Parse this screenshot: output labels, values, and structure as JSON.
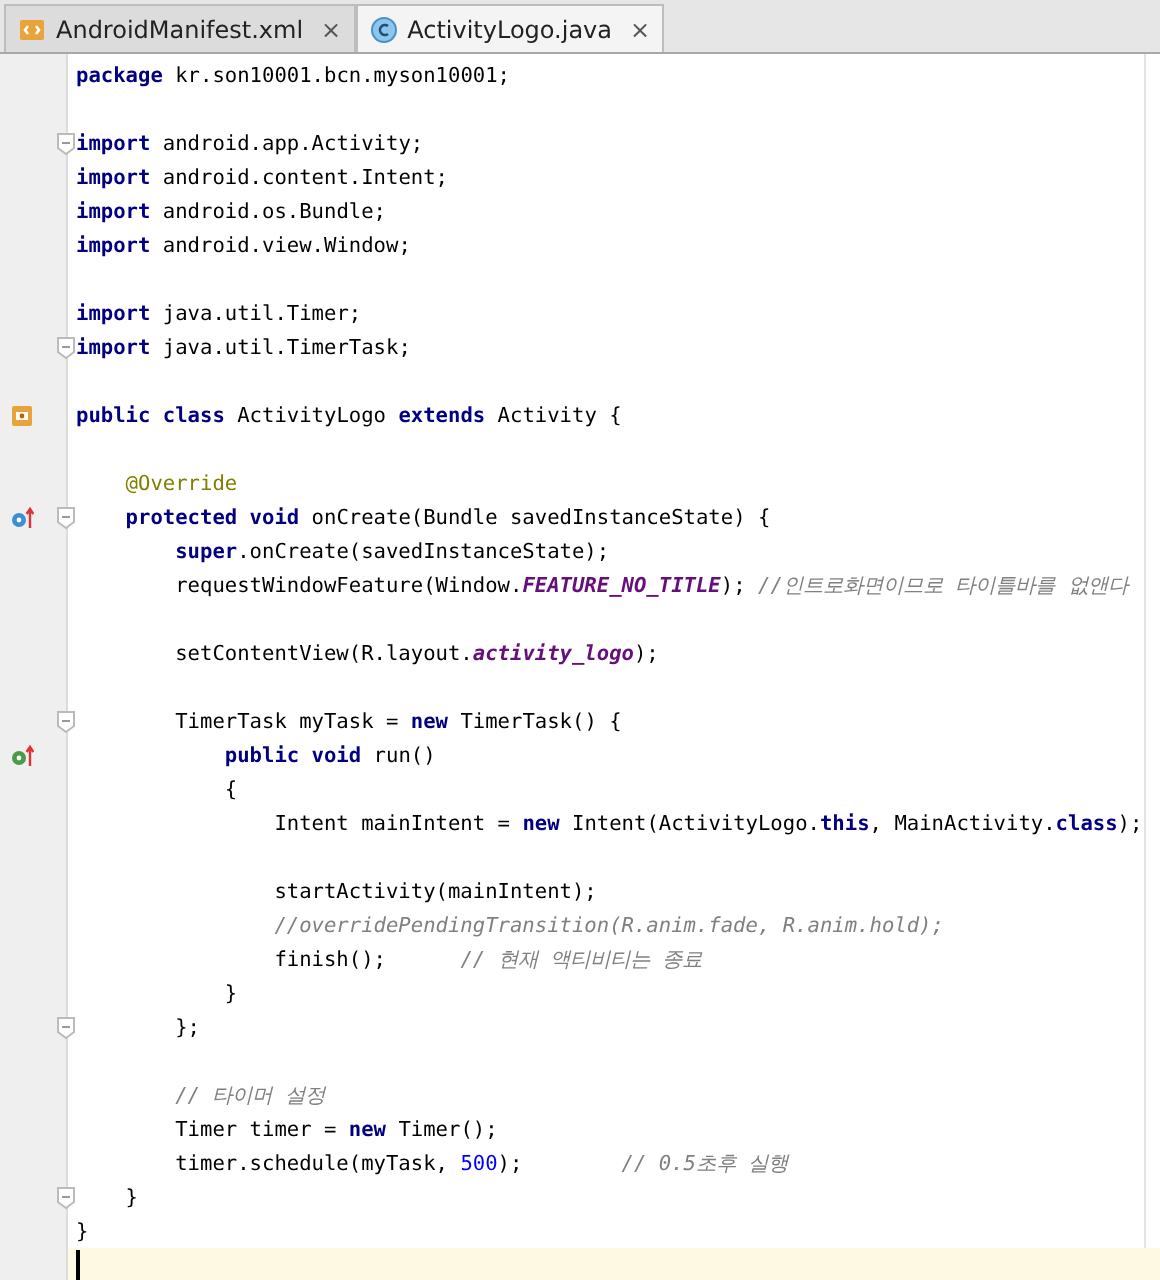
{
  "tabs": [
    {
      "label": "AndroidManifest.xml",
      "kind": "xml",
      "selected": false,
      "close": "×"
    },
    {
      "label": "ActivityLogo.java",
      "kind": "class",
      "selected": true,
      "close": "×"
    }
  ],
  "lines": [
    {
      "tokens": [
        {
          "kind": "keyword",
          "text": "package"
        },
        {
          "kind": "plain",
          "text": " kr.son10001.bcn.myson10001;"
        }
      ]
    },
    {
      "gap_before": true,
      "fold": true,
      "tokens": [
        {
          "kind": "keyword",
          "text": "import"
        },
        {
          "kind": "plain",
          "text": " android.app.Activity;"
        }
      ]
    },
    {
      "tokens": [
        {
          "kind": "keyword",
          "text": "import"
        },
        {
          "kind": "plain",
          "text": " android.content.Intent;"
        }
      ]
    },
    {
      "tokens": [
        {
          "kind": "keyword",
          "text": "import"
        },
        {
          "kind": "plain",
          "text": " android.os.Bundle;"
        }
      ]
    },
    {
      "tokens": [
        {
          "kind": "keyword",
          "text": "import"
        },
        {
          "kind": "plain",
          "text": " android.view.Window;"
        }
      ]
    },
    {
      "gap_before": true,
      "tokens": [
        {
          "kind": "keyword",
          "text": "import"
        },
        {
          "kind": "plain",
          "text": " java.util.Timer;"
        }
      ]
    },
    {
      "fold": true,
      "tokens": [
        {
          "kind": "keyword",
          "text": "import"
        },
        {
          "kind": "plain",
          "text": " java.util.TimerTask;"
        }
      ]
    },
    {
      "gap_before": true,
      "gutter": {
        "kind": "class"
      },
      "tokens": [
        {
          "kind": "keyword",
          "text": "public class"
        },
        {
          "kind": "plain",
          "text": " ActivityLogo "
        },
        {
          "kind": "keyword",
          "text": "extends"
        },
        {
          "kind": "plain",
          "text": " Activity {"
        }
      ]
    },
    {
      "gap_before": true,
      "tokens": [
        {
          "kind": "annotation",
          "text": "    @Override"
        }
      ]
    },
    {
      "gutter": {
        "kind": "override"
      },
      "fold": true,
      "tokens": [
        {
          "kind": "keyword",
          "text": "    protected void"
        },
        {
          "kind": "plain",
          "text": " onCreate(Bundle savedInstanceState) {"
        }
      ]
    },
    {
      "tokens": [
        {
          "kind": "keyword",
          "text": "        super"
        },
        {
          "kind": "plain",
          "text": ".onCreate(savedInstanceState);"
        }
      ]
    },
    {
      "tokens": [
        {
          "kind": "plain",
          "text": "        requestWindowFeature(Window."
        },
        {
          "kind": "field",
          "text": "FEATURE_NO_TITLE"
        },
        {
          "kind": "plain",
          "text": "); "
        },
        {
          "kind": "comment",
          "text": "//인트로화면이므로 타이틀바를 없앤다"
        }
      ]
    },
    {
      "gap_before": true,
      "tokens": [
        {
          "kind": "plain",
          "text": "        setContentView(R.layout."
        },
        {
          "kind": "field",
          "text": "activity_logo"
        },
        {
          "kind": "plain",
          "text": ");"
        }
      ]
    },
    {
      "gap_before": true,
      "fold": true,
      "tokens": [
        {
          "kind": "plain",
          "text": "        TimerTask myTask = "
        },
        {
          "kind": "keyword",
          "text": "new"
        },
        {
          "kind": "plain",
          "text": " TimerTask() {"
        }
      ]
    },
    {
      "gutter": {
        "kind": "implement"
      },
      "tokens": [
        {
          "kind": "keyword",
          "text": "            public void"
        },
        {
          "kind": "plain",
          "text": " run()"
        }
      ]
    },
    {
      "tokens": [
        {
          "kind": "plain",
          "text": "            {"
        }
      ]
    },
    {
      "tokens": [
        {
          "kind": "plain",
          "text": "                Intent mainIntent = "
        },
        {
          "kind": "keyword",
          "text": "new"
        },
        {
          "kind": "plain",
          "text": " Intent(ActivityLogo."
        },
        {
          "kind": "keyword",
          "text": "this"
        },
        {
          "kind": "plain",
          "text": ", MainActivity."
        },
        {
          "kind": "keyword",
          "text": "class"
        },
        {
          "kind": "plain",
          "text": ");"
        }
      ]
    },
    {
      "gap_before": true,
      "tokens": [
        {
          "kind": "plain",
          "text": "                startActivity(mainIntent);"
        }
      ]
    },
    {
      "tokens": [
        {
          "kind": "comment",
          "text": "                //overridePendingTransition(R.anim.fade, R.anim.hold);"
        }
      ]
    },
    {
      "tokens": [
        {
          "kind": "plain",
          "text": "                finish();      "
        },
        {
          "kind": "comment",
          "text": "// 현재 액티비티는 종료"
        }
      ]
    },
    {
      "tokens": [
        {
          "kind": "plain",
          "text": "            }"
        }
      ]
    },
    {
      "fold": true,
      "tokens": [
        {
          "kind": "plain",
          "text": "        };"
        }
      ]
    },
    {
      "gap_before": true,
      "tokens": [
        {
          "kind": "comment",
          "text": "        // 타이머 설정"
        }
      ]
    },
    {
      "tokens": [
        {
          "kind": "plain",
          "text": "        Timer timer = "
        },
        {
          "kind": "keyword",
          "text": "new"
        },
        {
          "kind": "plain",
          "text": " Timer();"
        }
      ]
    },
    {
      "tokens": [
        {
          "kind": "plain",
          "text": "        timer.schedule(myTask, "
        },
        {
          "kind": "number",
          "text": "500"
        },
        {
          "kind": "plain",
          "text": ");        "
        },
        {
          "kind": "comment",
          "text": "// 0.5초후 실행"
        }
      ]
    },
    {
      "fold": true,
      "tokens": [
        {
          "kind": "plain",
          "text": "    }"
        }
      ]
    },
    {
      "tokens": [
        {
          "kind": "plain",
          "text": "}"
        }
      ]
    },
    {
      "current": true
    }
  ]
}
